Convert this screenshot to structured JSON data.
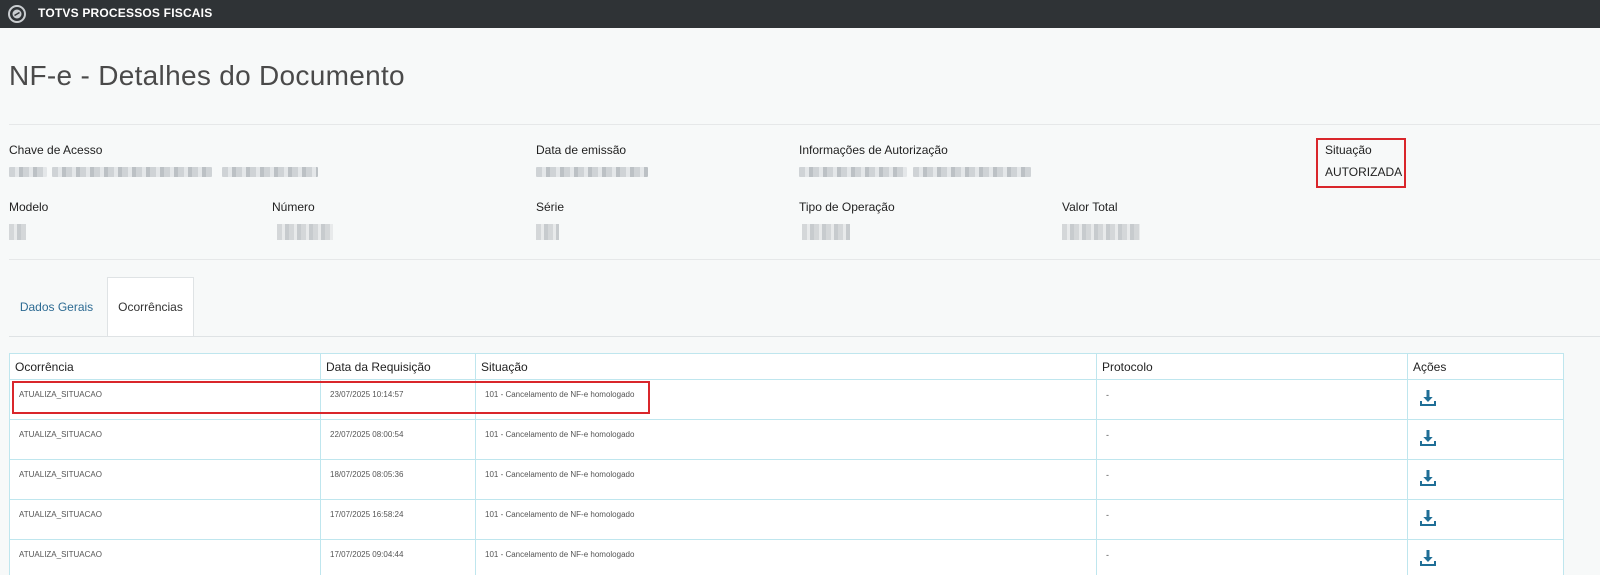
{
  "header": {
    "app_title": "TOTVS PROCESSOS FISCAIS",
    "logo_icon": "totvs-logo-icon"
  },
  "page": {
    "title": "NF-e - Detalhes do Documento"
  },
  "fields": {
    "chave_label": "Chave de Acesso",
    "data_emissao_label": "Data de emissão",
    "info_autorizacao_label": "Informações de Autorização",
    "situacao_label": "Situação",
    "situacao_value": "AUTORIZADA",
    "modelo_label": "Modelo",
    "numero_label": "Número",
    "serie_label": "Série",
    "tipo_operacao_label": "Tipo de Operação",
    "valor_total_label": "Valor Total"
  },
  "tabs": [
    {
      "label": "Dados Gerais",
      "active": false
    },
    {
      "label": "Ocorrências",
      "active": true
    }
  ],
  "table": {
    "columns": [
      "Ocorrência",
      "Data da Requisição",
      "Situação",
      "Protocolo",
      "Ações"
    ],
    "rows": [
      {
        "ocorrencia": "ATUALIZA_SITUACAO",
        "data": "23/07/2025 10:14:57",
        "situacao": "101 - Cancelamento de NF-e homologado",
        "protocolo": "-"
      },
      {
        "ocorrencia": "ATUALIZA_SITUACAO",
        "data": "22/07/2025 08:00:54",
        "situacao": "101 - Cancelamento de NF-e homologado",
        "protocolo": "-"
      },
      {
        "ocorrencia": "ATUALIZA_SITUACAO",
        "data": "18/07/2025 08:05:36",
        "situacao": "101 - Cancelamento de NF-e homologado",
        "protocolo": "-"
      },
      {
        "ocorrencia": "ATUALIZA_SITUACAO",
        "data": "17/07/2025 16:58:24",
        "situacao": "101 - Cancelamento de NF-e homologado",
        "protocolo": "-"
      },
      {
        "ocorrencia": "ATUALIZA_SITUACAO",
        "data": "17/07/2025 09:04:44",
        "situacao": "101 - Cancelamento de NF-e homologado",
        "protocolo": "-"
      }
    ],
    "action_icon": "download-icon"
  },
  "colors": {
    "topbar": "#2f3336",
    "highlight": "#d9262b",
    "link": "#2d6b93",
    "icon": "#1f6e96"
  }
}
